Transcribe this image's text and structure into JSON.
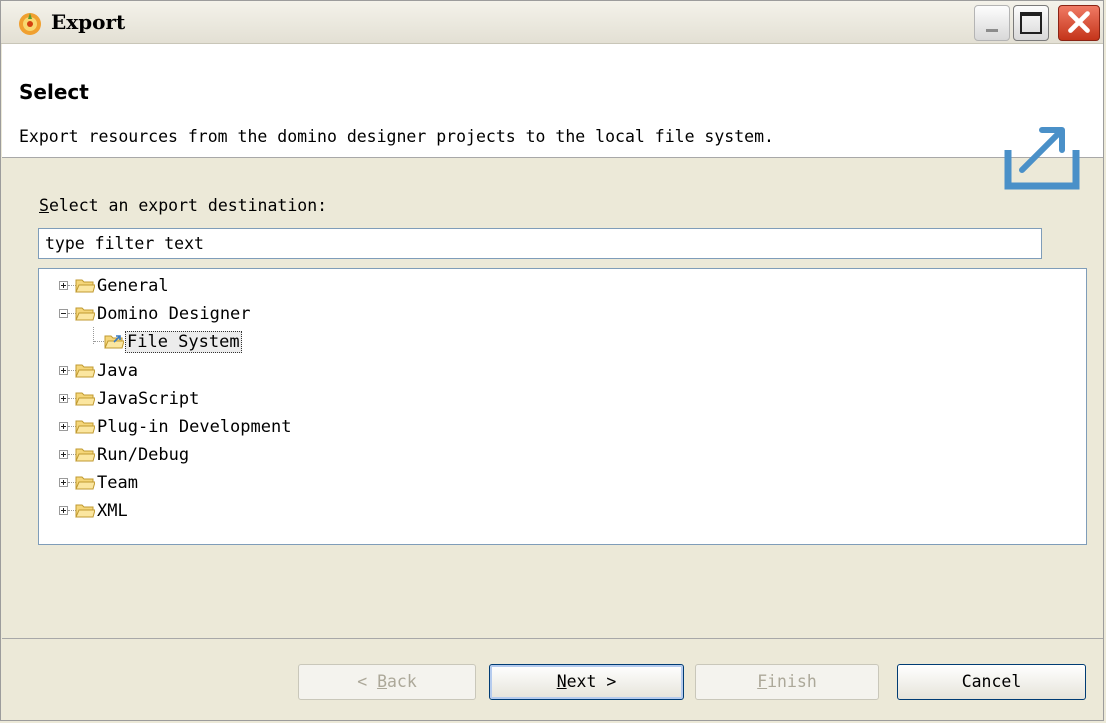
{
  "window": {
    "title": "Export"
  },
  "banner": {
    "title": "Select",
    "description": "Export resources from the domino designer projects to the local file system."
  },
  "destination": {
    "label_mnemonic": "S",
    "label_rest": "elect an export destination:",
    "filter_value": "type filter text"
  },
  "tree": {
    "items": [
      {
        "label": "General",
        "expanded": false
      },
      {
        "label": "Domino Designer",
        "expanded": true
      },
      {
        "label": "File System",
        "child": true,
        "selected": true
      },
      {
        "label": "Java",
        "expanded": false
      },
      {
        "label": "JavaScript",
        "expanded": false
      },
      {
        "label": "Plug-in Development",
        "expanded": false
      },
      {
        "label": "Run/Debug",
        "expanded": false
      },
      {
        "label": "Team",
        "expanded": false
      },
      {
        "label": "XML",
        "expanded": false
      }
    ]
  },
  "buttons": {
    "back": {
      "pre": "< ",
      "mnemonic": "B",
      "rest": "ack",
      "enabled": false
    },
    "next": {
      "mnemonic": "N",
      "rest": "ext >",
      "enabled": true
    },
    "finish": {
      "mnemonic": "F",
      "rest": "inish",
      "enabled": false
    },
    "cancel": {
      "label": "Cancel",
      "enabled": true
    }
  },
  "colors": {
    "folder": "#f5d67a",
    "close_button": "#d44a2e",
    "banner_icon": "#4a90c8"
  },
  "icons": {
    "app": "domino-app-icon",
    "banner": "export-icon",
    "folder": "folder-icon"
  }
}
